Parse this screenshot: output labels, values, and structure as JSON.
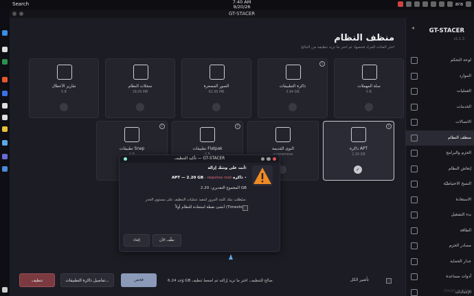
{
  "topbar": {
    "search": "Search",
    "time": "7:40 AM",
    "date": "9/20/26",
    "lang": "ara"
  },
  "window": {
    "title": "GT-STACER"
  },
  "sidebar": {
    "brand": "GT-STACER",
    "version": "v1.1.3",
    "items": [
      "لوحة التحكم",
      "الموارد",
      "العمليات",
      "الخدمات",
      "الاتصالات",
      "منظف النظام",
      "الحزم والبرامج",
      "إنعاش النظام",
      "النسخ الاحتياطيّة",
      "الاستعادة",
      "بدء التشغيل",
      "الطاقة",
      "مصادر الحزم",
      "جدار الحماية",
      "أدوات مساعدة",
      "الإعدادات"
    ],
    "active_index": 5,
    "footer": "STACER © 2026"
  },
  "page": {
    "title": "منظف النظام",
    "subtitle": "اختر الفئات المراد فحصها، ثم اختر ما تريد تنظيفه من النتائج"
  },
  "cards": [
    {
      "name": "سلة المهملات",
      "size": "0 B",
      "icon": "trash-icon",
      "info": false,
      "selected": false
    },
    {
      "name": "ذاكرة التطبيقات",
      "size": "3.94 GB",
      "icon": "database-icon",
      "info": true,
      "selected": false
    },
    {
      "name": "الصور المصغرة",
      "size": "82.96 MB",
      "icon": "image-icon",
      "info": false,
      "selected": false
    },
    {
      "name": "سجلات النظام",
      "size": "18.00 MB",
      "icon": "file-icon",
      "info": false,
      "selected": false
    },
    {
      "name": "تقارير الأعطال",
      "size": "0 B",
      "icon": "crash-file-icon",
      "info": false,
      "selected": false
    },
    {
      "name": "ذاكرة APT",
      "size": "2.20 GB",
      "icon": "package-icon",
      "info": true,
      "selected": true
    },
    {
      "name": "النوى القديمة",
      "size": "autoremove",
      "icon": "chip-icon",
      "info": false,
      "selected": false
    },
    {
      "name": "تطبيقات Flatpak",
      "size": "0 B",
      "icon": "cube-icon",
      "info": true,
      "selected": false
    },
    {
      "name": "تطبيقات Snap",
      "size": "0 B",
      "icon": "help-icon",
      "info": true,
      "selected": false
    }
  ],
  "dialog": {
    "title": "تأكيد التنظيف — GT-STACER",
    "heading": "أنت على وشك إزالة:",
    "item_label": "ذاكرة",
    "item_main": "APT — 2.20 GB",
    "item_root": "requires root",
    "total": "المجموع التقديري: 2.20 GB",
    "note": "سيُطلب منك كلمة المرور لتنفيذ عمليات التنظيف على مستوى الجذر.",
    "checkbox": "أنشئ نقطة استعادة للنظام أولاً (Timeshift)",
    "ok": "نظّف الآن",
    "cancel": "إلغاء"
  },
  "bottom": {
    "clean": "تنظيف",
    "details": "تفاصيل ذاكرة التطبيقات...",
    "scan": "فحص",
    "status": "وُجد 6.24 GB صالح للتنظيف. اختر ما تريد إزالته ثم اضغط تنظيف.",
    "select_all": "تأشير الكل"
  },
  "colors": {
    "accent": "#c8c8d0",
    "danger": "#7a3a40",
    "scan": "#8a9ab8",
    "warning": "#f08a24"
  }
}
